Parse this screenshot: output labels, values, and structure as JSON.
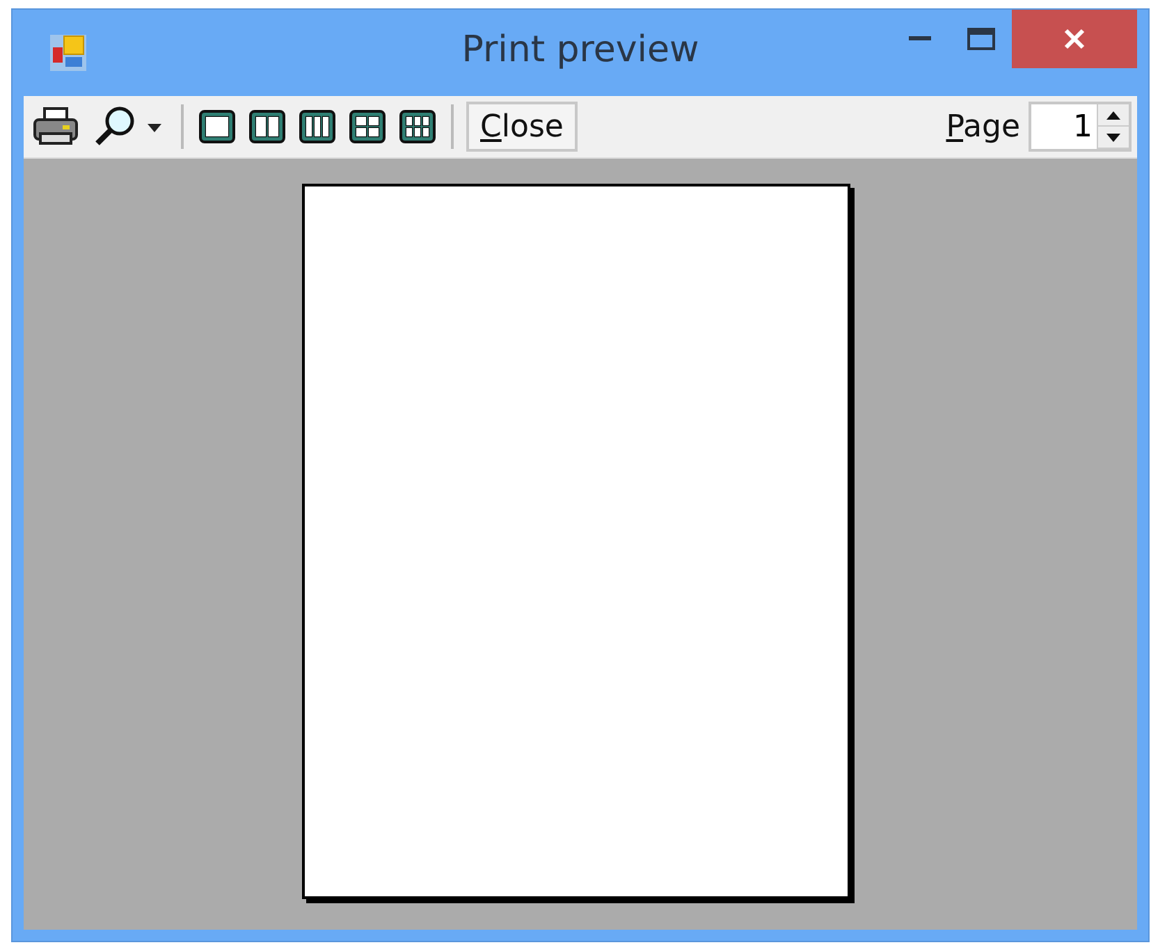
{
  "window": {
    "title": "Print preview"
  },
  "toolbar": {
    "close_button": "Close",
    "page_label": "Page",
    "page_value": "1"
  }
}
